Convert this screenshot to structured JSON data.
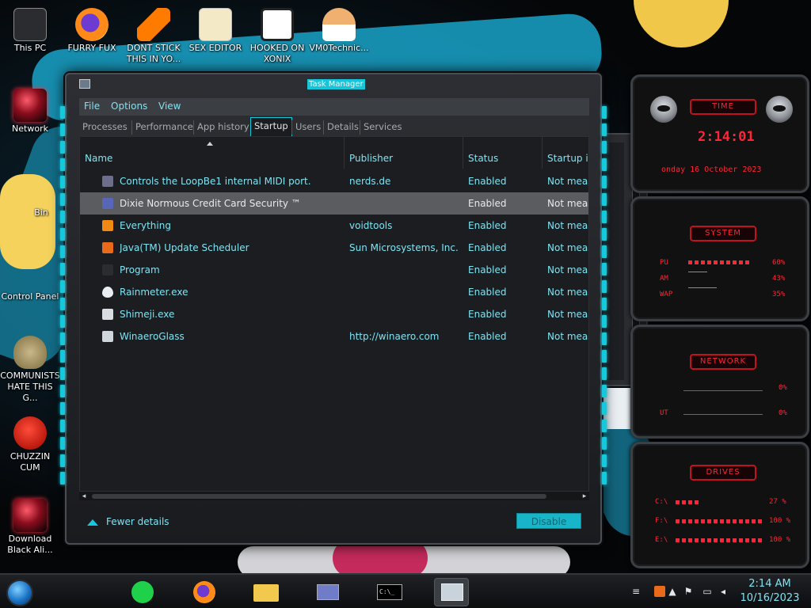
{
  "desktop_icons": [
    {
      "label": "This PC",
      "icon": "this-pc-icon"
    },
    {
      "label": "FURRY FUX",
      "icon": "firefox-icon"
    },
    {
      "label": "DONT STICK THIS IN YO...",
      "icon": "vlc-cone-icon"
    },
    {
      "label": "SEX EDITOR",
      "icon": "hxd-editor-icon"
    },
    {
      "label": "HOOKED ON XONIX",
      "icon": "xonix-game-icon"
    },
    {
      "label": "VM0Technic...",
      "icon": "doctor-avatar-icon"
    },
    {
      "label": "Network",
      "icon": "alien-orb-icon"
    },
    {
      "label": "Bin",
      "icon": "recycle-bin-icon"
    },
    {
      "label": "Control Panel",
      "icon": "control-panel-icon"
    },
    {
      "label": "COMMUNISTS HATE THIS G...",
      "icon": "money-bag-icon"
    },
    {
      "label": "CHUZZIN CUM",
      "icon": "chuzzle-icon"
    },
    {
      "label": "Download Black Ali...",
      "icon": "alien-orb-icon"
    }
  ],
  "task_manager": {
    "title": "Task Manager",
    "menu": [
      "File",
      "Options",
      "View"
    ],
    "tabs": [
      "Processes",
      "Performance",
      "App history",
      "Startup",
      "Users",
      "Details",
      "Services"
    ],
    "active_tab": "Startup",
    "columns": [
      "Name",
      "Publisher",
      "Status",
      "Startup im"
    ],
    "rows": [
      {
        "name": "Controls the LoopBe1 internal MIDI port.",
        "publisher": "nerds.de",
        "status": "Enabled",
        "impact": "Not meas",
        "icon": "midi-icon"
      },
      {
        "name": "Dixie Normous Credit Card Security ™",
        "publisher": "",
        "status": "Enabled",
        "impact": "Not meas",
        "icon": "credit-card-icon",
        "selected": true
      },
      {
        "name": "Everything",
        "publisher": "voidtools",
        "status": "Enabled",
        "impact": "Not meas",
        "icon": "magnifier-icon"
      },
      {
        "name": "Java(TM) Update Scheduler",
        "publisher": "Sun Microsystems, Inc.",
        "status": "Enabled",
        "impact": "Not meas",
        "icon": "java-icon"
      },
      {
        "name": "Program",
        "publisher": "",
        "status": "Enabled",
        "impact": "Not meas",
        "icon": "program-icon"
      },
      {
        "name": "Rainmeter.exe",
        "publisher": "",
        "status": "Enabled",
        "impact": "Not meas",
        "icon": "rainmeter-drop-icon"
      },
      {
        "name": "Shimeji.exe",
        "publisher": "",
        "status": "Enabled",
        "impact": "Not meas",
        "icon": "window-app-icon"
      },
      {
        "name": "WinaeroGlass",
        "publisher": "http://winaero.com",
        "status": "Enabled",
        "impact": "Not meas",
        "icon": "glass-window-icon"
      }
    ],
    "fewer_details": "Fewer details",
    "disable_button": "Disable"
  },
  "rainmeter": {
    "time": {
      "header": "TIME",
      "clock": "2:14:01",
      "date": "onday 16 October 2023"
    },
    "system": {
      "header": "SYSTEM",
      "rows": [
        {
          "label": "PU",
          "value": "60%",
          "level": 0.6
        },
        {
          "label": "AM",
          "value": "43%",
          "level": 0.43
        },
        {
          "label": "WAP",
          "value": "35%",
          "level": 0.35
        }
      ]
    },
    "network": {
      "header": "NETWORK",
      "rows": [
        {
          "label": "",
          "value": "0%"
        },
        {
          "label": "UT",
          "value": "0%"
        }
      ]
    },
    "drives": {
      "header": "DRIVES",
      "rows": [
        {
          "label": "C:\\",
          "value": "27 %",
          "level": 0.27
        },
        {
          "label": "F:\\",
          "value": "100 %",
          "level": 1.0
        },
        {
          "label": "E:\\",
          "value": "100 %",
          "level": 1.0
        }
      ]
    }
  },
  "taskbar": {
    "pinned": [
      "start-orb-icon",
      "notes-app-icon",
      "firefox-icon",
      "file-explorer-icon",
      "control-panel-icon",
      "command-prompt-icon",
      "task-manager-icon"
    ],
    "tray_icons": [
      "network-bars-icon",
      "java-tray-icon",
      "up-arrow-icon",
      "flag-icon",
      "network-icon",
      "volume-icon"
    ],
    "time": "2:14 AM",
    "date": "10/16/2023"
  },
  "colors": {
    "accent_cyan": "#16c8dc",
    "text_cyan": "#7fe3f2",
    "rainmeter_red": "#ff2436",
    "window_bg": "#1c1d20"
  }
}
